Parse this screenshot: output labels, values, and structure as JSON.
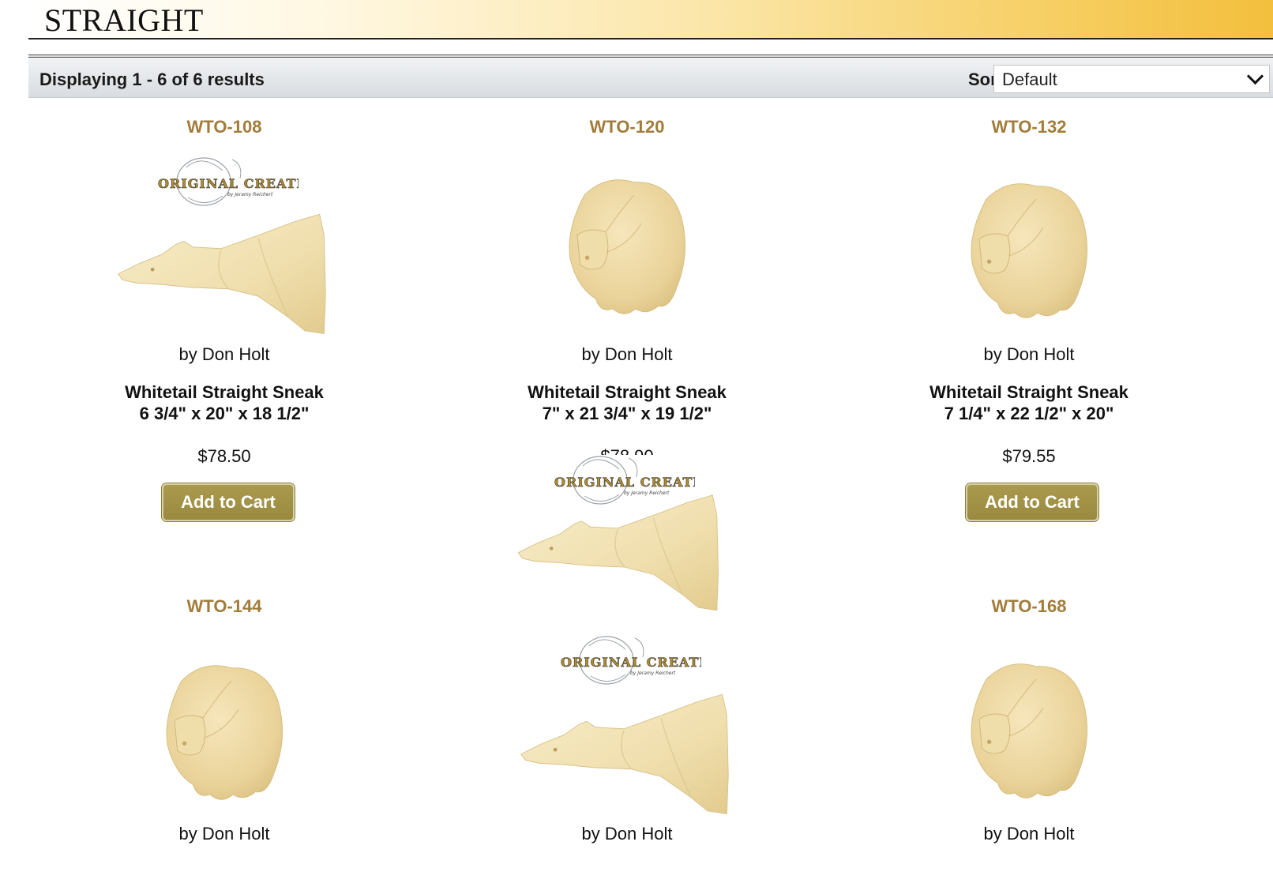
{
  "page": {
    "title": "STRAIGHT"
  },
  "results": {
    "text": "Displaying 1 - 6 of 6 results"
  },
  "sort": {
    "label": "Sort:",
    "selected": "Default"
  },
  "logo": {
    "text": "ORIGINAL CREATIONS"
  },
  "colors": {
    "sku": "#a17c3a",
    "button": "#9a8a3f",
    "form": "#f2e3b6"
  },
  "products": [
    {
      "sku": "WTO-108",
      "author": "by Don Holt",
      "name": "Whitetail Straight Sneak",
      "size": "6 3/4\" x 20\" x 18 1/2\"",
      "price": "$78.50",
      "button": "Add to Cart",
      "image": "side-view-form-with-logo"
    },
    {
      "sku": "WTO-120",
      "author": "by Don Holt",
      "name": "Whitetail Straight Sneak",
      "size": "7\" x 21 3/4\" x 19 1/2\"",
      "price": "$78.90",
      "image": "front-view-form"
    },
    {
      "sku": "WTO-132",
      "author": "by Don Holt",
      "name": "Whitetail Straight Sneak",
      "size": "7 1/4\" x 22 1/2\" x 20\"",
      "price": "$79.55",
      "button": "Add to Cart",
      "image": "front-view-form"
    },
    {
      "sku": "WTO-144",
      "author": "by Don Holt",
      "image": "front-view-form"
    },
    {
      "sku": "",
      "author": "by Don Holt",
      "image": "side-view-form-with-logo"
    },
    {
      "sku": "WTO-168",
      "author": "by Don Holt",
      "image": "front-view-form"
    }
  ]
}
